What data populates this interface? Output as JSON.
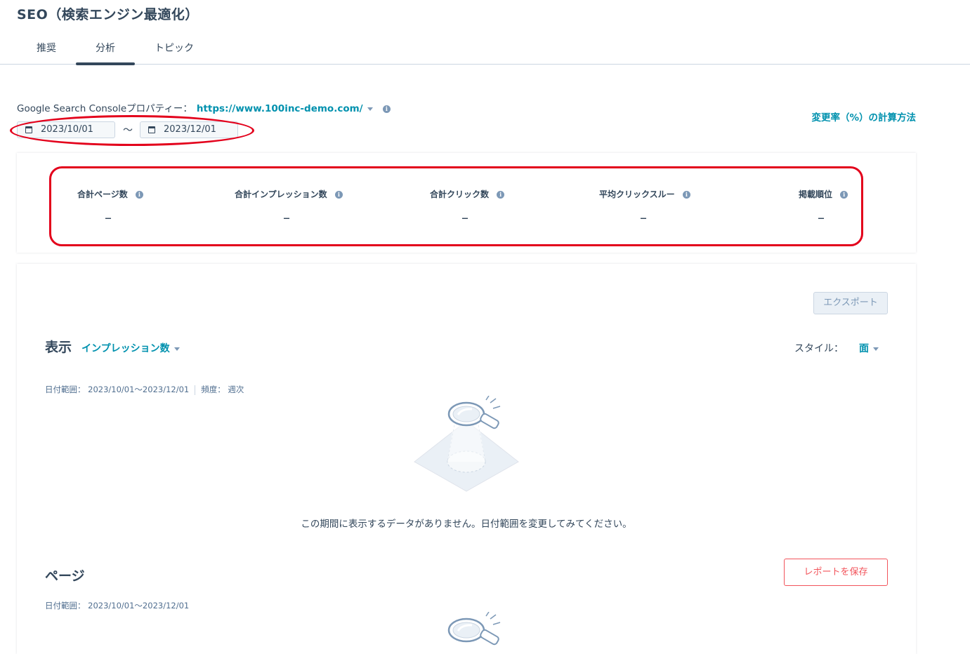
{
  "page": {
    "title": "SEO（検索エンジン最適化）"
  },
  "tabs": [
    {
      "label": "推奨"
    },
    {
      "label": "分析",
      "active": true
    },
    {
      "label": "トピック"
    }
  ],
  "property": {
    "label": "Google Search Consoleプロパティー：",
    "url": "https://www.100inc-demo.com/"
  },
  "calc_link": "変更率（%）の計算方法",
  "date_range": {
    "start": "2023/10/01",
    "separator": "〜",
    "end": "2023/12/01"
  },
  "kpis": [
    {
      "label": "合計ページ数",
      "value": "–"
    },
    {
      "label": "合計インプレッション数",
      "value": "–"
    },
    {
      "label": "合計クリック数",
      "value": "–"
    },
    {
      "label": "平均クリックスルー",
      "value": "–"
    },
    {
      "label": "掲載順位",
      "value": "–"
    }
  ],
  "display_section": {
    "export_label": "エクスポート",
    "title": "表示",
    "metric": "インプレッション数",
    "style_label": "スタイル：",
    "style_value": "面",
    "date_meta": "日付範囲： 2023/10/01〜2023/12/01",
    "freq_meta": "頻度： 週次",
    "empty_message": "この期間に表示するデータがありません。日付範囲を変更してみてください。"
  },
  "pages_section": {
    "title": "ページ",
    "save_label": "レポートを保存",
    "date_meta": "日付範囲： 2023/10/01〜2023/12/01"
  },
  "colors": {
    "text": "#33475b",
    "link": "#0091ae",
    "annotation_red": "#e3001b",
    "save_button": "#f2545b"
  }
}
